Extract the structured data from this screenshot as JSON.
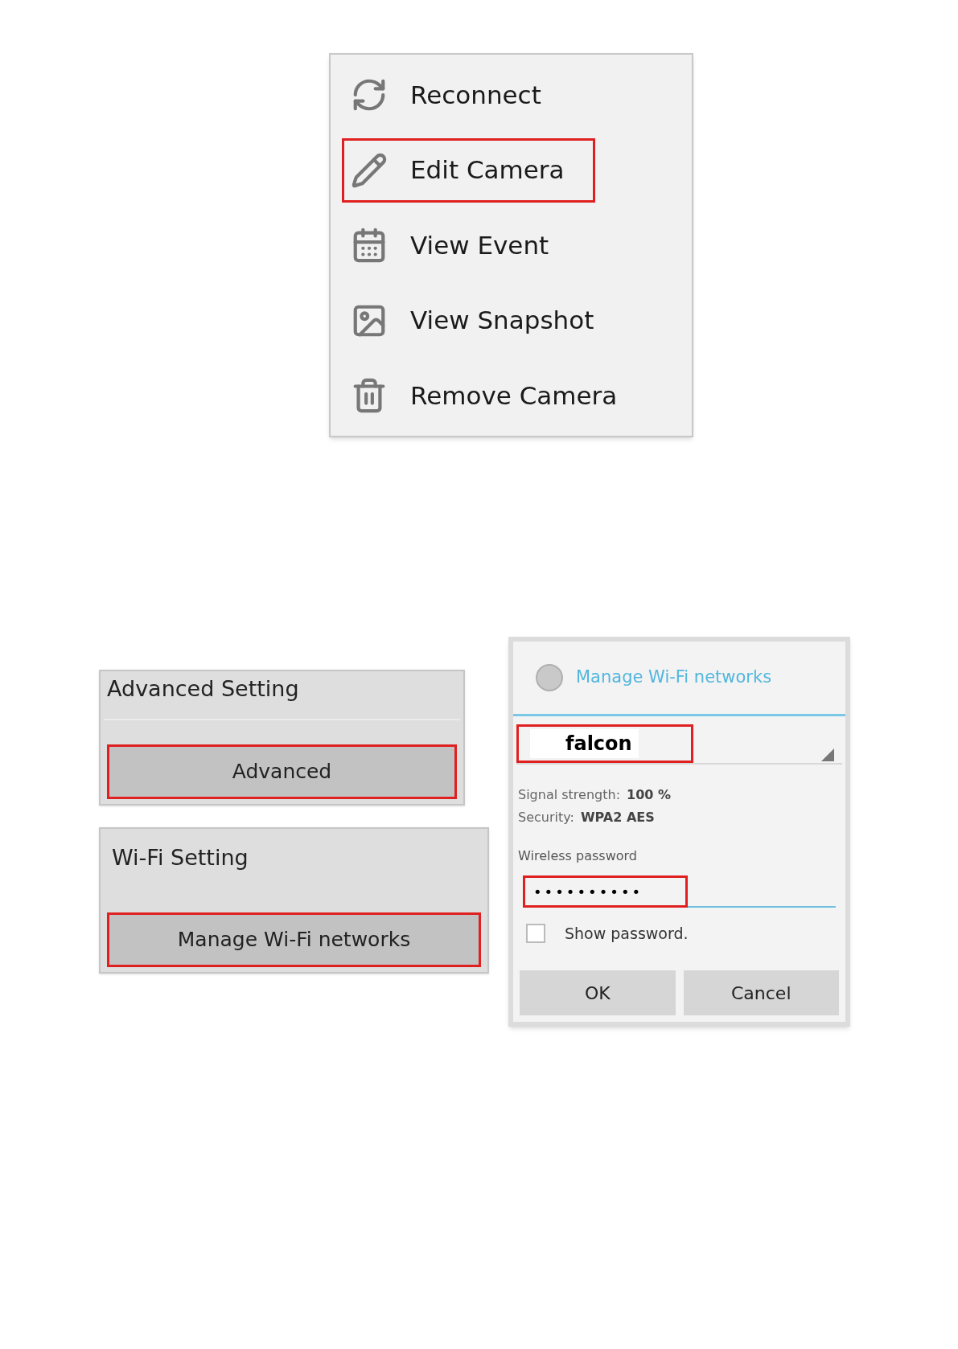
{
  "menu": {
    "items": [
      {
        "kind": "reconnect",
        "label": "Reconnect",
        "highlighted": false
      },
      {
        "kind": "edit",
        "label": "Edit Camera",
        "highlighted": true
      },
      {
        "kind": "event",
        "label": "View Event",
        "highlighted": false
      },
      {
        "kind": "snapshot",
        "label": "View Snapshot",
        "highlighted": false
      },
      {
        "kind": "remove",
        "label": "Remove Camera",
        "highlighted": false
      }
    ]
  },
  "panels": [
    {
      "title": "Advanced Setting",
      "button": "Advanced",
      "highlighted": true
    },
    {
      "title": "Wi-Fi Setting",
      "button": "Manage Wi-Fi networks",
      "highlighted": true
    }
  ],
  "dialog": {
    "title": "Manage Wi-Fi networks",
    "network": {
      "value": "falcon",
      "highlighted": true
    },
    "info": [
      {
        "label": "Signal strength:",
        "value": "100 %"
      },
      {
        "label": "Security:",
        "value": "WPA2 AES"
      }
    ],
    "password": {
      "label": "Wireless password",
      "value": "••••••••••",
      "highlighted": true
    },
    "show_password": {
      "label": "Show password.",
      "checked": false
    },
    "buttons": [
      "OK",
      "Cancel"
    ]
  }
}
